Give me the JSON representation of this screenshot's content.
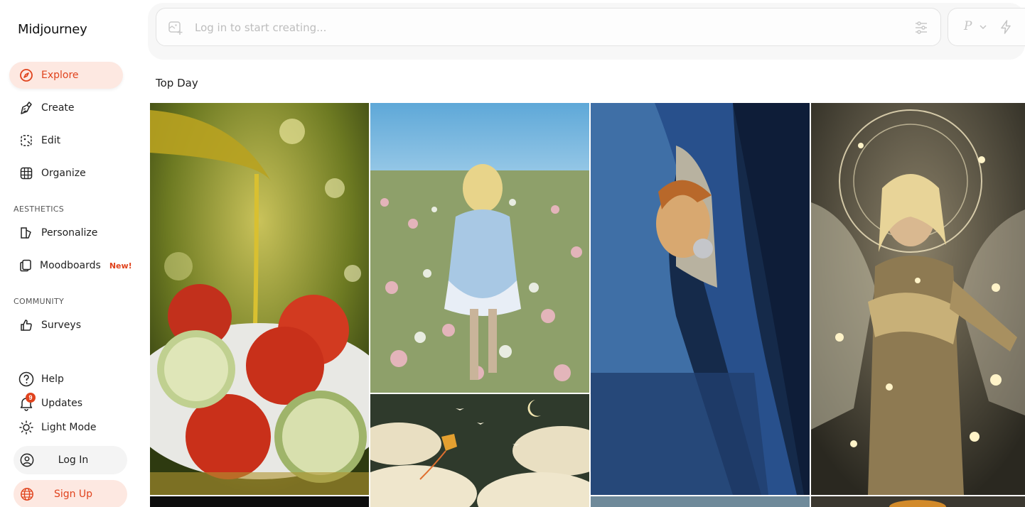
{
  "app": {
    "brand": "Midjourney"
  },
  "nav": [
    {
      "label": "Explore",
      "icon": "compass-icon",
      "active": true
    },
    {
      "label": "Create",
      "icon": "brush-icon"
    },
    {
      "label": "Edit",
      "icon": "edit-frame-icon"
    },
    {
      "label": "Organize",
      "icon": "grid-icon"
    }
  ],
  "aesthetics": {
    "title": "AESTHETICS",
    "items": [
      {
        "label": "Personalize",
        "icon": "personalize-icon"
      },
      {
        "label": "Moodboards",
        "icon": "moodboards-icon",
        "tag": "New!"
      }
    ]
  },
  "community": {
    "title": "COMMUNITY",
    "items": [
      {
        "label": "Surveys",
        "icon": "thumbs-up-icon"
      }
    ]
  },
  "footer": {
    "help": "Help",
    "updates": "Updates",
    "updates_badge": "9",
    "light_mode": "Light Mode",
    "login": "Log In",
    "signup": "Sign Up"
  },
  "prompt": {
    "placeholder": "Log in to start creating...",
    "mode_letter": "P"
  },
  "gallery": {
    "heading": "Top Day",
    "images": [
      {
        "subject": "olive oil on tomato and cucumber salad"
      },
      {
        "subject": "girl walking in flower field"
      },
      {
        "subject": "anime boy looking out train window"
      },
      {
        "subject": "golden armored angel with magic circle"
      },
      {
        "subject": "kite with birds among clouds at night"
      }
    ]
  },
  "colors": {
    "accent": "#e0431d",
    "active_bg": "#fde8e1"
  }
}
